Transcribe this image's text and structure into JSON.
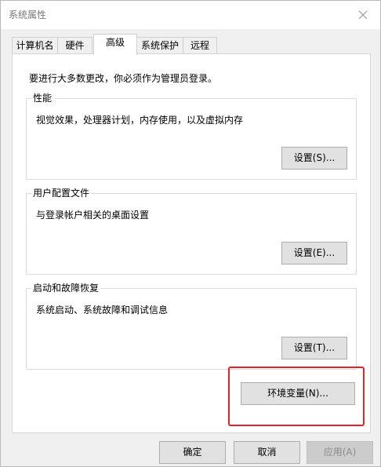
{
  "window": {
    "title": "系统属性",
    "close_icon": "close-icon"
  },
  "tabs": [
    {
      "label": "计算机名",
      "active": false
    },
    {
      "label": "硬件",
      "active": false
    },
    {
      "label": "高级",
      "active": true
    },
    {
      "label": "系统保护",
      "active": false
    },
    {
      "label": "远程",
      "active": false
    }
  ],
  "advanced": {
    "note": "要进行大多数更改，你必须作为管理员登录。",
    "performance": {
      "label": "性能",
      "description": "视觉效果，处理器计划，内存使用，以及虚拟内存",
      "button": "设置(S)..."
    },
    "user_profiles": {
      "label": "用户配置文件",
      "description": "与登录帐户相关的桌面设置",
      "button": "设置(E)..."
    },
    "startup_recovery": {
      "label": "启动和故障恢复",
      "description": "系统启动、系统故障和调试信息",
      "button": "设置(T)..."
    },
    "env_button": "环境变量(N)..."
  },
  "footer": {
    "ok": "确定",
    "cancel": "取消",
    "apply": "应用(A)"
  },
  "colors": {
    "highlight": "#e2242a",
    "dialog_bg": "#f0f0f0",
    "panel_bg": "#ffffff",
    "button_bg": "#e1e1e1",
    "disabled_text": "#8a8a8a"
  }
}
